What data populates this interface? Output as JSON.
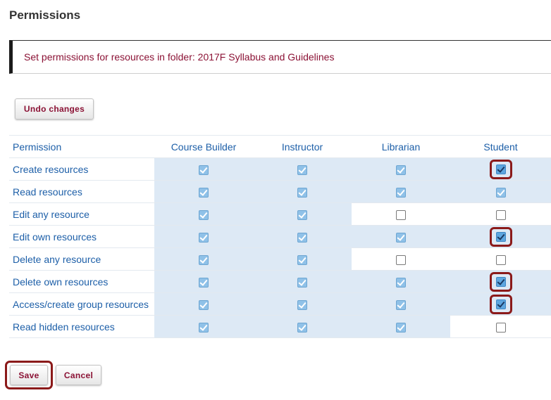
{
  "page": {
    "title": "Permissions",
    "instruction": "Set permissions for resources in folder: 2017F Syllabus and Guidelines"
  },
  "buttons": {
    "undo": "Undo changes",
    "save": "Save",
    "cancel": "Cancel"
  },
  "table": {
    "headers": [
      "Permission",
      "Course Builder",
      "Instructor",
      "Librarian",
      "Student"
    ],
    "rows": [
      {
        "label": "Create resources",
        "values": [
          true,
          true,
          true,
          true
        ],
        "highlight": [
          false,
          false,
          false,
          true
        ]
      },
      {
        "label": "Read resources",
        "values": [
          true,
          true,
          true,
          true
        ],
        "highlight": [
          false,
          false,
          false,
          false
        ]
      },
      {
        "label": "Edit any resource",
        "values": [
          true,
          true,
          false,
          false
        ],
        "highlight": [
          false,
          false,
          false,
          false
        ]
      },
      {
        "label": "Edit own resources",
        "values": [
          true,
          true,
          true,
          true
        ],
        "highlight": [
          false,
          false,
          false,
          true
        ]
      },
      {
        "label": "Delete any resource",
        "values": [
          true,
          true,
          false,
          false
        ],
        "highlight": [
          false,
          false,
          false,
          false
        ]
      },
      {
        "label": "Delete own resources",
        "values": [
          true,
          true,
          true,
          true
        ],
        "highlight": [
          false,
          false,
          false,
          true
        ]
      },
      {
        "label": "Access/create group resources",
        "values": [
          true,
          true,
          true,
          true
        ],
        "highlight": [
          false,
          false,
          false,
          true
        ]
      },
      {
        "label": "Read hidden resources",
        "values": [
          true,
          true,
          true,
          false
        ],
        "highlight": [
          false,
          false,
          false,
          false
        ]
      }
    ]
  },
  "colors": {
    "accent": "#8b1235",
    "link": "#1d5fa8",
    "cell_on": "#dde9f5",
    "highlight_ring": "#8b1a1a"
  }
}
